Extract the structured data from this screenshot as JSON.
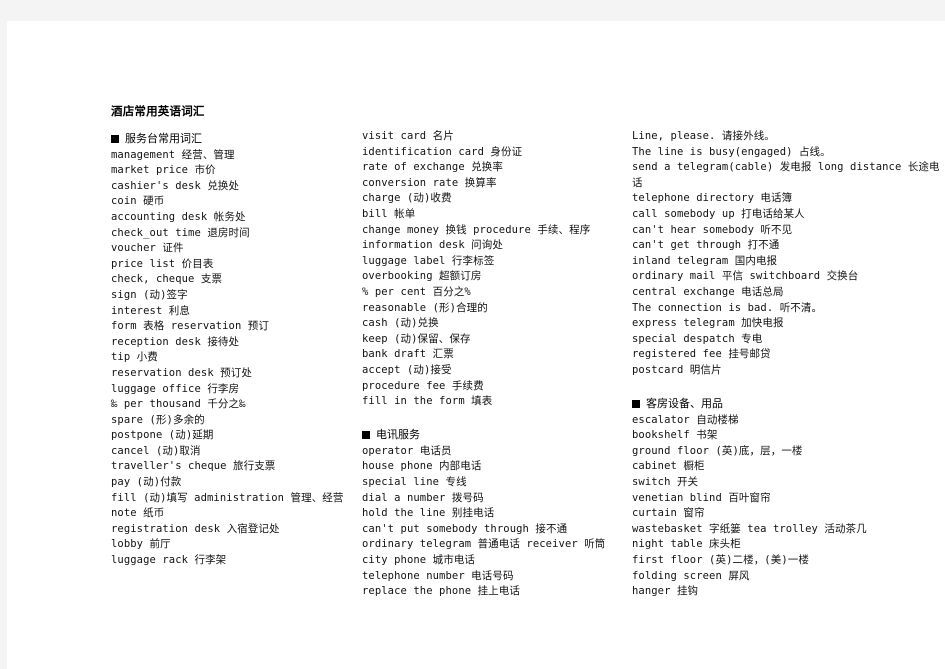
{
  "document": {
    "title": "酒店常用英语词汇",
    "background_color": "#ffffff",
    "page_border_color": "#f4f4f4",
    "text_color": "#111111"
  },
  "columns": {
    "left": {
      "section": {
        "bullet": "black-square-bullet",
        "label": "服务台常用词汇"
      },
      "entries": [
        "management 经营、管理",
        "market price 市价",
        "cashier's desk 兑换处",
        "coin 硬币",
        "accounting desk 帐务处",
        "check_out time 退房时间",
        "voucher 证件",
        "price list 价目表",
        "check, cheque 支票",
        "sign (动)签字",
        "interest 利息",
        "form 表格 reservation 预订",
        "reception desk 接待处",
        "tip 小费",
        "reservation desk 预订处",
        "luggage office 行李房",
        "‰ per thousand 千分之‰",
        "spare (形)多余的",
        "postpone (动)延期",
        "cancel (动)取消",
        "traveller's cheque 旅行支票",
        "pay (动)付款",
        "fill (动)填写 administration 管理、经营",
        "note 纸币",
        "registration desk 入宿登记处",
        "lobby 前厅",
        "luggage rack 行李架"
      ]
    },
    "middle": {
      "entries_top": [
        "visit card 名片",
        "identification card 身份证",
        "rate of exchange 兑换率",
        "conversion rate 换算率",
        "charge (动)收费",
        "bill 帐单",
        "change money 换钱 procedure 手续、程序",
        "information desk 问询处",
        "luggage label 行李标签",
        "overbooking 超额订房",
        "% per cent 百分之%",
        "reasonable (形)合理的",
        "cash (动)兑换",
        "keep (动)保留、保存",
        "bank draft 汇票",
        "accept (动)接受",
        "procedure fee 手续费",
        "fill in the form 填表"
      ],
      "section": {
        "bullet": "black-square-bullet",
        "label": "电讯服务"
      },
      "entries_bottom": [
        "operator 电话员",
        "house phone 内部电话",
        "special line 专线",
        "dial a number  拨号码",
        "hold the line  别挂电话",
        "can't put somebody through  接不通",
        "ordinary telegram 普通电话 receiver 听筒",
        "city phone 城市电话",
        "telephone number 电话号码",
        "replace the phone  挂上电话"
      ]
    },
    "right": {
      "entries_top": [
        "Line, please.   请接外线。",
        "The line is busy(engaged)  占线。",
        "send a telegram(cable) 发电报 long distance 长途电话",
        "telephone directory 电话簿",
        "call somebody up  打电话给某人",
        "can't hear somebody  听不见",
        "can't get through  打不通",
        "inland telegram 国内电报",
        "ordinary mail 平信 switchboard 交换台",
        "central exchange 电话总局",
        "The connection is bad.  听不清。",
        "express telegram 加快电报",
        "special despatch 专电",
        "registered fee 挂号邮贷",
        "postcard 明信片"
      ],
      "section": {
        "bullet": "black-square-bullet",
        "label": "客房设备、用品"
      },
      "entries_bottom": [
        "escalator 自动楼梯",
        "bookshelf 书架",
        "ground floor (英)底，层，一楼",
        "cabinet 橱柜",
        "switch 开关",
        "venetian blind 百叶窗帘",
        "curtain 窗帘",
        "wastebasket 字纸篓 tea trolley 活动茶几",
        "night table 床头柜",
        "first floor (英)二楼，(美)一楼",
        "folding screen 屏风",
        "hanger 挂钩"
      ]
    }
  }
}
